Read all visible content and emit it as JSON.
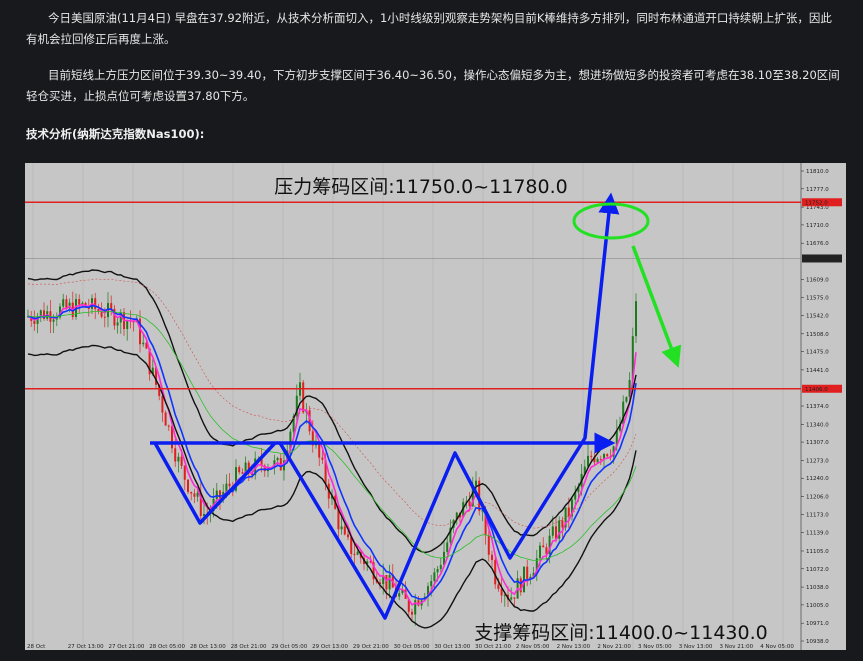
{
  "article": {
    "paragraph1": "今日美国原油(11月4日) 早盘在37.92附近，从技术分析面切入，1小时线级别观察走势架构目前K棒维持多方排列，同时布林通道开口持续朝上扩张，因此有机会拉回修正后再度上涨。",
    "paragraph2": "目前短线上方压力区间位于39.30~39.40，下方初步支撑区间于36.40~36.50，操作心态偏短多为主，想进场做短多的投资者可考虑在38.10至38.20区间轻仓买进，止损点位可考虑设置37.80下方。",
    "subtitle": "技术分析(纳斯达克指数Nas100):"
  },
  "chart_data": {
    "type": "candlestick",
    "instrument": "Nas100",
    "resistance_label": "压力筹码区间:11750.0~11780.0",
    "support_label": "支撑筹码区间:11400.0~11430.0",
    "price_axis": {
      "ticks": [
        "11810.0",
        "11777.0",
        "11743.0",
        "11710.0",
        "11676.0",
        "11609.0",
        "11575.0",
        "11542.0",
        "11508.0",
        "11475.0",
        "11441.0",
        "11374.0",
        "11340.0",
        "11307.0",
        "11273.0",
        "11240.0",
        "11206.0",
        "11173.0",
        "11139.0",
        "11105.0",
        "11072.0",
        "11038.0",
        "11005.0",
        "10971.0",
        "10938.0"
      ],
      "range": [
        10938,
        11810
      ],
      "resistance_line_value": 11752.0,
      "resistance_line_text": "11752.0",
      "current_price_text": "11647.7",
      "support_line_value": 11406.0,
      "support_line_text": "11406.0"
    },
    "time_axis": [
      "28 Oct",
      "27 Oct 13:00",
      "27 Oct 21:00",
      "28 Oct 05:00",
      "28 Oct 13:00",
      "28 Oct 21:00",
      "29 Oct 05:00",
      "29 Oct 13:00",
      "29 Oct 21:00",
      "30 Oct 05:00",
      "30 Oct 13:00",
      "30 Oct 21:00",
      "2 Nov 05:00",
      "2 Nov 13:00",
      "2 Nov 21:00",
      "3 Nov 05:00",
      "3 Nov 13:00",
      "3 Nov 21:00",
      "4 Nov 05:00"
    ],
    "colors": {
      "background": "#c6c6c6",
      "bull_candle": "#1c7a1c",
      "bear_candle": "#e02020",
      "level_line": "#e02020",
      "bollinger": "#111111",
      "ma_fast": "#ff2bd6",
      "ma_mid": "#1033ff",
      "annotation_arrow": "#0a1ef0",
      "projection_arrow": "#22e022"
    }
  }
}
